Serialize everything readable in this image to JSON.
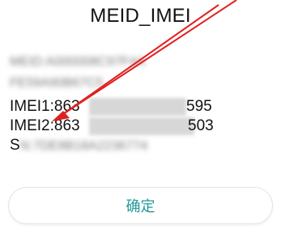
{
  "dialog": {
    "title": "MEID_IMEI",
    "lines": {
      "meid_1": "MEID:A000008C97F4A",
      "meid_2": "FE59A90B67C5",
      "imei1_visible_prefix": "IMEI1:863",
      "imei1_visible_suffix": "595",
      "imei2_visible_prefix": "IMEI2:863",
      "imei2_visible_suffix": "503",
      "sn_prefix": "S",
      "sn_blurred": "N:7DE8B18A2236774"
    },
    "confirm_label": "确定",
    "colors": {
      "accent": "#1e9a9a",
      "annotation_arrow": "#e02020"
    }
  }
}
